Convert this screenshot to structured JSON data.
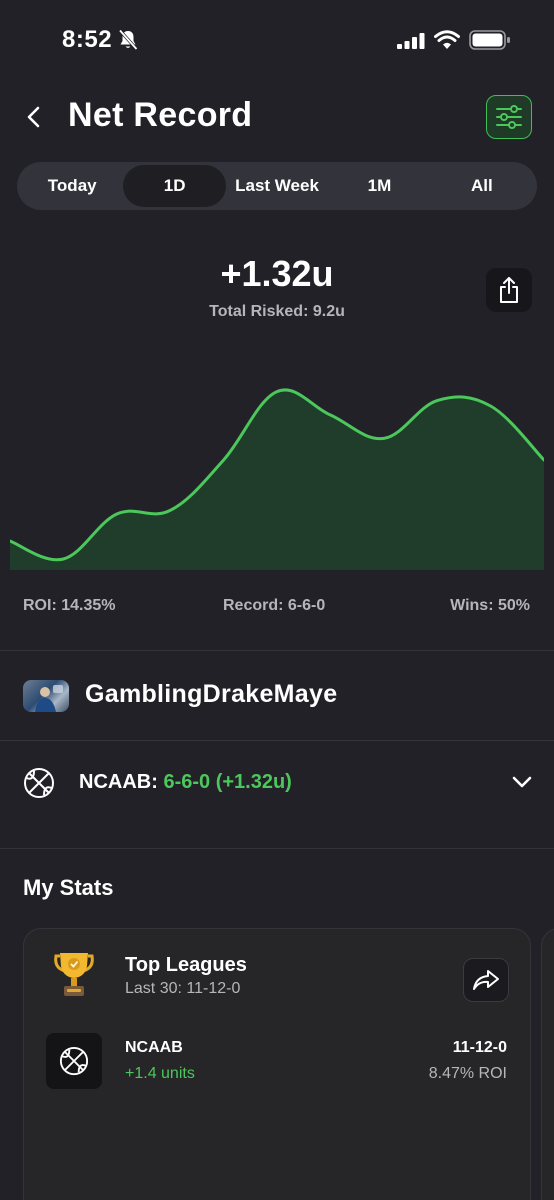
{
  "status_bar": {
    "time": "8:52",
    "icons": [
      "bell-slash-icon",
      "cellular-signal-icon",
      "wifi-icon",
      "battery-icon"
    ]
  },
  "header": {
    "title": "Net Record",
    "back_icon": "chevron-left-icon",
    "filter_icon": "sliders-icon"
  },
  "tabs": [
    {
      "label": "Today",
      "active": false
    },
    {
      "label": "1D",
      "active": true
    },
    {
      "label": "Last Week",
      "active": false
    },
    {
      "label": "1M",
      "active": false
    },
    {
      "label": "All",
      "active": false
    }
  ],
  "summary": {
    "net_units": "+1.32u",
    "total_risked": "Total Risked: 9.2u",
    "share_icon": "share-icon"
  },
  "chart_data": {
    "type": "area",
    "x": [
      0,
      1,
      2,
      3,
      4,
      5,
      6,
      7,
      8,
      9,
      10
    ],
    "values": [
      0.15,
      0.05,
      0.3,
      0.32,
      0.6,
      0.98,
      0.85,
      0.72,
      0.93,
      0.9,
      0.6
    ],
    "title": "",
    "xlabel": "",
    "ylabel": "",
    "grid": false,
    "color": "#4cc75b"
  },
  "stats": {
    "roi": "ROI: 14.35%",
    "record": "Record: 6-6-0",
    "wins": "Wins: 50%"
  },
  "user": {
    "username": "GamblingDrakeMaye"
  },
  "league_summary": {
    "league": "NCAAB:",
    "record": "6-6-0 (+1.32u)",
    "icon": "basketball-icon",
    "expand_icon": "chevron-down-icon"
  },
  "my_stats": {
    "heading": "My Stats",
    "card": {
      "title": "Top Leagues",
      "subtitle": "Last 30: 11-12-0",
      "icon": "trophy-icon",
      "share_icon": "share-arrow-icon",
      "rows": [
        {
          "league": "NCAAB",
          "units": "+1.4 units",
          "record": "11-12-0",
          "roi": "8.47% ROI"
        }
      ]
    }
  },
  "colors": {
    "background": "#212127",
    "accent_green": "#4cc75b",
    "muted_text": "#b5b5bb"
  }
}
